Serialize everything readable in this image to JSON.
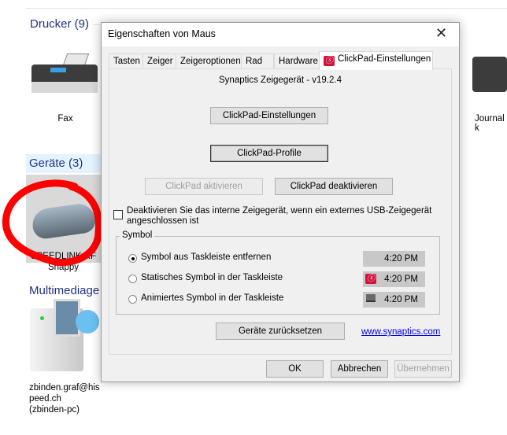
{
  "explorer": {
    "groups": [
      {
        "label": "Drucker (9)"
      },
      {
        "label": "Geräte (3)"
      },
      {
        "label": "Multimediage"
      }
    ],
    "items": {
      "fax": "Fax",
      "journal": "Journal\nk",
      "mouse_line1": "SPEEDLINK RF",
      "mouse_line2": "Snappy",
      "media_line1": "zbinden.graf@his",
      "media_line2": "peed.ch",
      "media_line3": "(zbinden-pc)"
    }
  },
  "dialog": {
    "title": "Eigenschaften von Maus",
    "tabs": [
      {
        "label": "Tasten"
      },
      {
        "label": "Zeiger"
      },
      {
        "label": "Zeigeroptionen"
      },
      {
        "label": "Rad"
      },
      {
        "label": "Hardware"
      },
      {
        "label": "ClickPad-Einstellungen",
        "active": true
      }
    ],
    "version": "Synaptics Zeigegerät - v19.2.4",
    "buttons": {
      "settings": "ClickPad-Einstellungen",
      "profiles": "ClickPad-Profile",
      "activate": "ClickPad aktivieren",
      "deactivate": "ClickPad deaktivieren",
      "reset": "Geräte zurücksetzen",
      "ok": "OK",
      "cancel": "Abbrechen",
      "apply": "Übernehmen"
    },
    "checkbox": {
      "label_line1": "Deaktivieren Sie das interne Zeigegerät, wenn ein externes USB-Zeigegerät",
      "label_line2": "angeschlossen ist",
      "checked": false
    },
    "symbol_group": {
      "legend": "Symbol",
      "options": [
        {
          "label": "Symbol aus Taskleiste entfernen",
          "selected": true,
          "time": "4:20 PM"
        },
        {
          "label": "Statisches Symbol in der Taskleiste",
          "selected": false,
          "time": "4:20 PM"
        },
        {
          "label": "Animiertes Symbol in der Taskleiste",
          "selected": false,
          "time": "4:20 PM"
        }
      ]
    },
    "link": "www.synaptics.com",
    "accent": "#d2143a",
    "annotation_color": "#ff0000"
  }
}
